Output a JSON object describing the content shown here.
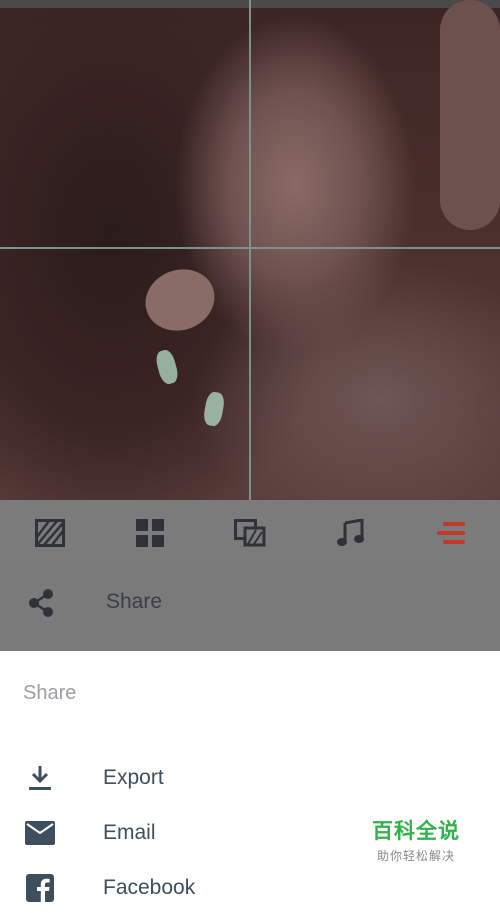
{
  "colors": {
    "accent_red": "#c0392b",
    "icon_dark": "#2f3236",
    "sheet_text": "#3d4f5c",
    "watermark_green": "#2fb34a"
  },
  "toolbar": {
    "items": [
      {
        "icon": "hatch-icon"
      },
      {
        "icon": "grid-icon"
      },
      {
        "icon": "layers-icon"
      },
      {
        "icon": "music-icon"
      },
      {
        "icon": "menu-lines-icon",
        "active": true
      }
    ]
  },
  "share_row": {
    "icon": "share-icon",
    "label": "Share"
  },
  "sheet": {
    "title": "Share",
    "items": [
      {
        "icon": "download-icon",
        "label": "Export"
      },
      {
        "icon": "email-icon",
        "label": "Email"
      },
      {
        "icon": "facebook-icon",
        "label": "Facebook"
      }
    ]
  },
  "watermark": {
    "main": "百科全说",
    "sub": "助你轻松解决"
  }
}
